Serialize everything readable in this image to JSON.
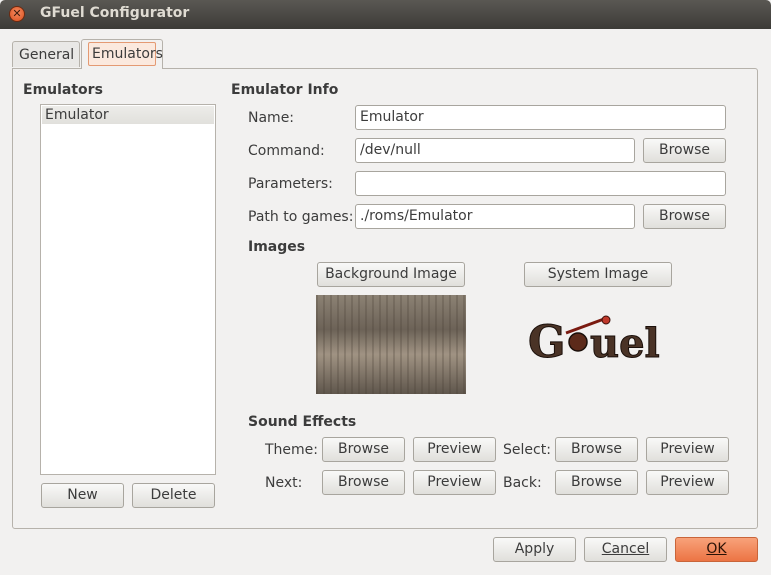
{
  "window": {
    "title": "GFuel Configurator"
  },
  "tabs": [
    {
      "label": "General"
    },
    {
      "label": "Emulators"
    }
  ],
  "emulators": {
    "heading": "Emulators",
    "items": [
      {
        "label": "Emulator"
      }
    ],
    "new_label": "New",
    "delete_label": "Delete"
  },
  "info": {
    "heading": "Emulator Info",
    "name_label": "Name:",
    "name_value": "Emulator",
    "command_label": "Command:",
    "command_value": "/dev/null",
    "parameters_label": "Parameters:",
    "parameters_value": "",
    "path_label": "Path to games:",
    "path_value": "./roms/Emulator",
    "browse_label": "Browse"
  },
  "images": {
    "heading": "Images",
    "background_label": "Background Image",
    "system_label": "System Image",
    "logo_text": "GFuel"
  },
  "sound": {
    "heading": "Sound Effects",
    "theme_label": "Theme:",
    "select_label": "Select:",
    "next_label": "Next:",
    "back_label": "Back:",
    "browse_label": "Browse",
    "preview_label": "Preview"
  },
  "footer": {
    "apply_label": "Apply",
    "cancel_label": "Cancel",
    "ok_label": "OK"
  },
  "colors": {
    "titlebar": "#3c3b37",
    "close_button": "#e05a2a",
    "ok_button": "#ec7444",
    "selected_tab_border": "#e49a73"
  }
}
